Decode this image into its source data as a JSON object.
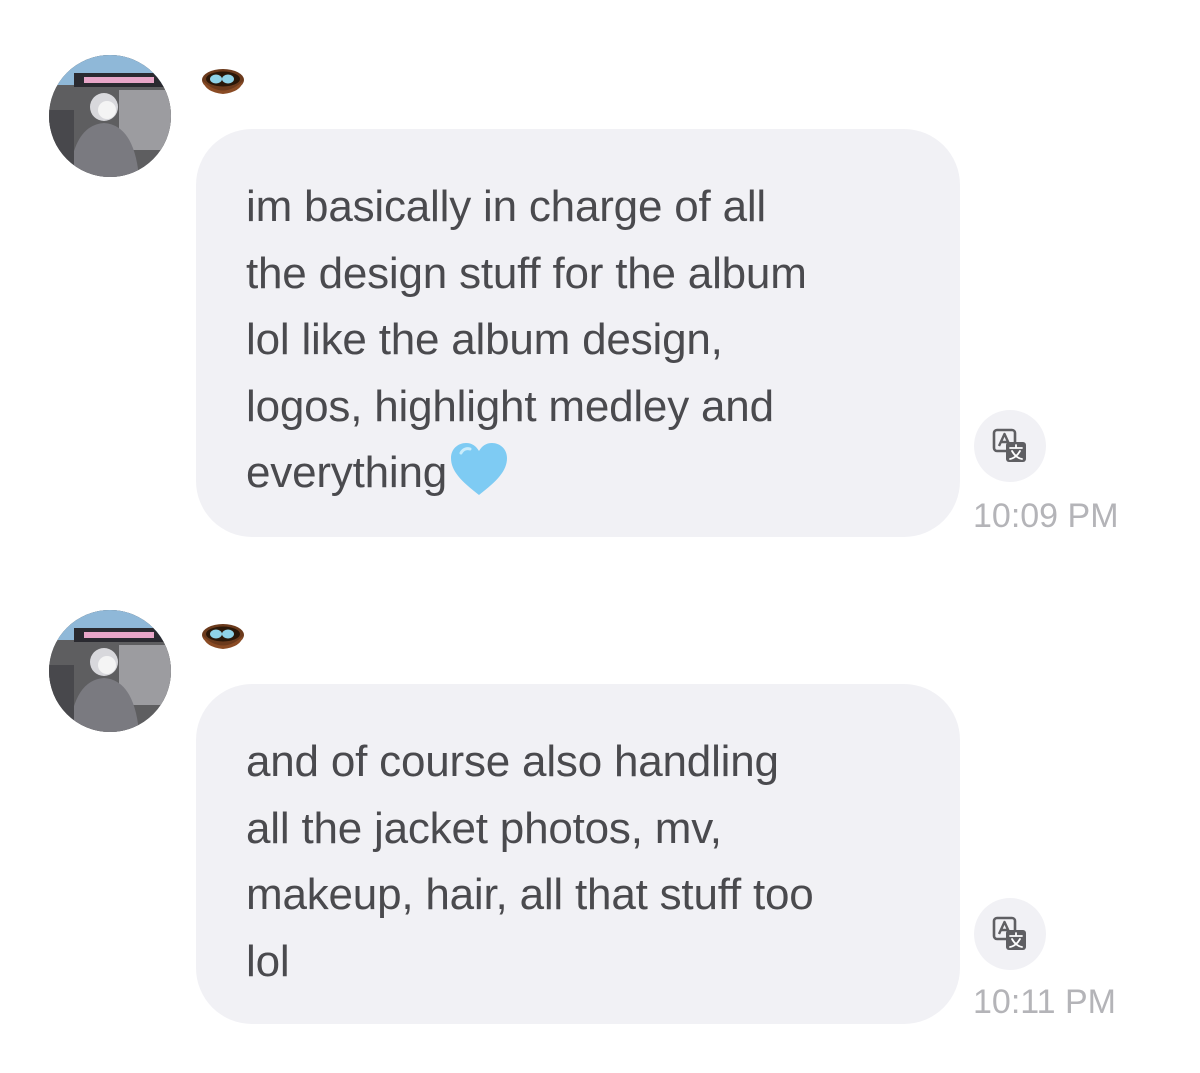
{
  "conversation": {
    "messages": [
      {
        "avatar_icon": "user-avatar-photo",
        "badge_icon": "nest-with-eggs-icon",
        "lines": [
          "im basically in charge of all",
          "the design stuff for the album",
          "lol like the album design,",
          "logos, highlight medley and",
          "everything"
        ],
        "trailing_emoji": "light-blue-heart-icon",
        "translate_icon": "translate-icon",
        "time": "10:09 PM"
      },
      {
        "avatar_icon": "user-avatar-photo",
        "badge_icon": "nest-with-eggs-icon",
        "lines": [
          "and of course also handling",
          "all the jacket photos, mv,",
          "makeup, hair, all that stuff too",
          "lol"
        ],
        "translate_icon": "translate-icon",
        "time": "10:11 PM"
      }
    ]
  },
  "colors": {
    "bubble_background": "#f1f1f5",
    "message_text": "#4a4a4e",
    "timestamp_text": "#b4b4b8",
    "heart": "#7ecbf3"
  }
}
